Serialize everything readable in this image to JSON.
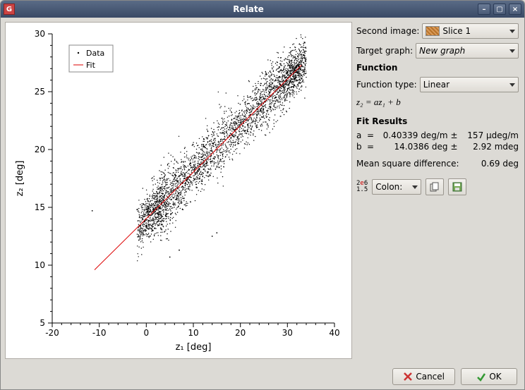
{
  "window": {
    "title": "Relate"
  },
  "side": {
    "second_image_label": "Second image:",
    "second_image_value": "Slice 1",
    "target_graph_label": "Target graph:",
    "target_graph_value": "New graph",
    "function_header": "Function",
    "function_type_label": "Function type:",
    "function_type_value": "Linear",
    "formula": "z₂ = az₁ + b",
    "fit_results_header": "Fit Results",
    "a_label": "a",
    "b_label": "b",
    "eq": "=",
    "a_value": "0.40339 deg/m",
    "a_pm": "±",
    "a_err": "157 µdeg/m",
    "b_value": "14.0386 deg",
    "b_pm": "±",
    "b_err": "2.92 mdeg",
    "msd_label": "Mean square difference:",
    "msd_value": "0.69 deg",
    "colon_label": "Colon:"
  },
  "buttons": {
    "cancel": "Cancel",
    "ok": "OK"
  },
  "chart": {
    "xlabel": "z₁ [deg]",
    "ylabel": "z₂ [deg]",
    "legend_data": "Data",
    "legend_fit": "Fit"
  },
  "xticks": {
    "m20": "-20",
    "m10": "-10",
    "p0": "0",
    "p10": "10",
    "p20": "20",
    "p30": "30",
    "p40": "40"
  },
  "yticks": {
    "y5": "5",
    "y10": "10",
    "y15": "15",
    "y20": "20",
    "y25": "25",
    "y30": "30"
  },
  "chart_data": {
    "type": "scatter",
    "title": "",
    "xlabel": "z₁ [deg]",
    "ylabel": "z₂ [deg]",
    "xlim": [
      -20,
      40
    ],
    "ylim": [
      5,
      30
    ],
    "series": [
      {
        "name": "Data",
        "kind": "scatter",
        "note": "Dense scatter cloud roughly following the Fit line; spread approx ±2 in z₂ around fit for 0 ≤ z₁ ≤ 33. Exact point coordinates not readable from image.",
        "x_range": [
          -11,
          33
        ],
        "y_range": [
          9,
          28
        ]
      },
      {
        "name": "Fit",
        "kind": "line",
        "equation": "z2 = 0.40339 * z1 + 14.0386",
        "x": [
          -11,
          33
        ],
        "y": [
          9.6,
          27.3
        ]
      }
    ],
    "legend_position": "upper left"
  }
}
